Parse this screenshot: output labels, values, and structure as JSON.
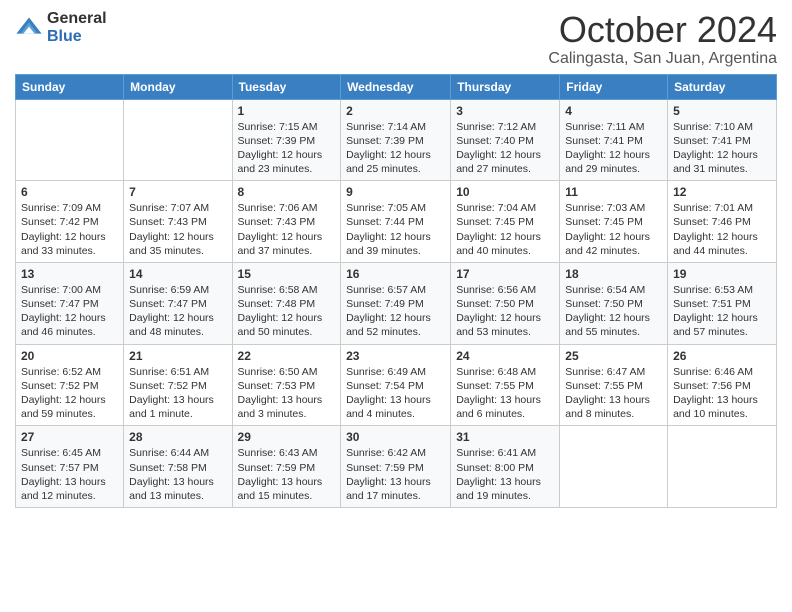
{
  "logo": {
    "general": "General",
    "blue": "Blue"
  },
  "header": {
    "month": "October 2024",
    "location": "Calingasta, San Juan, Argentina"
  },
  "weekdays": [
    "Sunday",
    "Monday",
    "Tuesday",
    "Wednesday",
    "Thursday",
    "Friday",
    "Saturday"
  ],
  "weeks": [
    [
      {
        "day": "",
        "sunrise": "",
        "sunset": "",
        "daylight": ""
      },
      {
        "day": "",
        "sunrise": "",
        "sunset": "",
        "daylight": ""
      },
      {
        "day": "1",
        "sunrise": "Sunrise: 7:15 AM",
        "sunset": "Sunset: 7:39 PM",
        "daylight": "Daylight: 12 hours and 23 minutes."
      },
      {
        "day": "2",
        "sunrise": "Sunrise: 7:14 AM",
        "sunset": "Sunset: 7:39 PM",
        "daylight": "Daylight: 12 hours and 25 minutes."
      },
      {
        "day": "3",
        "sunrise": "Sunrise: 7:12 AM",
        "sunset": "Sunset: 7:40 PM",
        "daylight": "Daylight: 12 hours and 27 minutes."
      },
      {
        "day": "4",
        "sunrise": "Sunrise: 7:11 AM",
        "sunset": "Sunset: 7:41 PM",
        "daylight": "Daylight: 12 hours and 29 minutes."
      },
      {
        "day": "5",
        "sunrise": "Sunrise: 7:10 AM",
        "sunset": "Sunset: 7:41 PM",
        "daylight": "Daylight: 12 hours and 31 minutes."
      }
    ],
    [
      {
        "day": "6",
        "sunrise": "Sunrise: 7:09 AM",
        "sunset": "Sunset: 7:42 PM",
        "daylight": "Daylight: 12 hours and 33 minutes."
      },
      {
        "day": "7",
        "sunrise": "Sunrise: 7:07 AM",
        "sunset": "Sunset: 7:43 PM",
        "daylight": "Daylight: 12 hours and 35 minutes."
      },
      {
        "day": "8",
        "sunrise": "Sunrise: 7:06 AM",
        "sunset": "Sunset: 7:43 PM",
        "daylight": "Daylight: 12 hours and 37 minutes."
      },
      {
        "day": "9",
        "sunrise": "Sunrise: 7:05 AM",
        "sunset": "Sunset: 7:44 PM",
        "daylight": "Daylight: 12 hours and 39 minutes."
      },
      {
        "day": "10",
        "sunrise": "Sunrise: 7:04 AM",
        "sunset": "Sunset: 7:45 PM",
        "daylight": "Daylight: 12 hours and 40 minutes."
      },
      {
        "day": "11",
        "sunrise": "Sunrise: 7:03 AM",
        "sunset": "Sunset: 7:45 PM",
        "daylight": "Daylight: 12 hours and 42 minutes."
      },
      {
        "day": "12",
        "sunrise": "Sunrise: 7:01 AM",
        "sunset": "Sunset: 7:46 PM",
        "daylight": "Daylight: 12 hours and 44 minutes."
      }
    ],
    [
      {
        "day": "13",
        "sunrise": "Sunrise: 7:00 AM",
        "sunset": "Sunset: 7:47 PM",
        "daylight": "Daylight: 12 hours and 46 minutes."
      },
      {
        "day": "14",
        "sunrise": "Sunrise: 6:59 AM",
        "sunset": "Sunset: 7:47 PM",
        "daylight": "Daylight: 12 hours and 48 minutes."
      },
      {
        "day": "15",
        "sunrise": "Sunrise: 6:58 AM",
        "sunset": "Sunset: 7:48 PM",
        "daylight": "Daylight: 12 hours and 50 minutes."
      },
      {
        "day": "16",
        "sunrise": "Sunrise: 6:57 AM",
        "sunset": "Sunset: 7:49 PM",
        "daylight": "Daylight: 12 hours and 52 minutes."
      },
      {
        "day": "17",
        "sunrise": "Sunrise: 6:56 AM",
        "sunset": "Sunset: 7:50 PM",
        "daylight": "Daylight: 12 hours and 53 minutes."
      },
      {
        "day": "18",
        "sunrise": "Sunrise: 6:54 AM",
        "sunset": "Sunset: 7:50 PM",
        "daylight": "Daylight: 12 hours and 55 minutes."
      },
      {
        "day": "19",
        "sunrise": "Sunrise: 6:53 AM",
        "sunset": "Sunset: 7:51 PM",
        "daylight": "Daylight: 12 hours and 57 minutes."
      }
    ],
    [
      {
        "day": "20",
        "sunrise": "Sunrise: 6:52 AM",
        "sunset": "Sunset: 7:52 PM",
        "daylight": "Daylight: 12 hours and 59 minutes."
      },
      {
        "day": "21",
        "sunrise": "Sunrise: 6:51 AM",
        "sunset": "Sunset: 7:52 PM",
        "daylight": "Daylight: 13 hours and 1 minute."
      },
      {
        "day": "22",
        "sunrise": "Sunrise: 6:50 AM",
        "sunset": "Sunset: 7:53 PM",
        "daylight": "Daylight: 13 hours and 3 minutes."
      },
      {
        "day": "23",
        "sunrise": "Sunrise: 6:49 AM",
        "sunset": "Sunset: 7:54 PM",
        "daylight": "Daylight: 13 hours and 4 minutes."
      },
      {
        "day": "24",
        "sunrise": "Sunrise: 6:48 AM",
        "sunset": "Sunset: 7:55 PM",
        "daylight": "Daylight: 13 hours and 6 minutes."
      },
      {
        "day": "25",
        "sunrise": "Sunrise: 6:47 AM",
        "sunset": "Sunset: 7:55 PM",
        "daylight": "Daylight: 13 hours and 8 minutes."
      },
      {
        "day": "26",
        "sunrise": "Sunrise: 6:46 AM",
        "sunset": "Sunset: 7:56 PM",
        "daylight": "Daylight: 13 hours and 10 minutes."
      }
    ],
    [
      {
        "day": "27",
        "sunrise": "Sunrise: 6:45 AM",
        "sunset": "Sunset: 7:57 PM",
        "daylight": "Daylight: 13 hours and 12 minutes."
      },
      {
        "day": "28",
        "sunrise": "Sunrise: 6:44 AM",
        "sunset": "Sunset: 7:58 PM",
        "daylight": "Daylight: 13 hours and 13 minutes."
      },
      {
        "day": "29",
        "sunrise": "Sunrise: 6:43 AM",
        "sunset": "Sunset: 7:59 PM",
        "daylight": "Daylight: 13 hours and 15 minutes."
      },
      {
        "day": "30",
        "sunrise": "Sunrise: 6:42 AM",
        "sunset": "Sunset: 7:59 PM",
        "daylight": "Daylight: 13 hours and 17 minutes."
      },
      {
        "day": "31",
        "sunrise": "Sunrise: 6:41 AM",
        "sunset": "Sunset: 8:00 PM",
        "daylight": "Daylight: 13 hours and 19 minutes."
      },
      {
        "day": "",
        "sunrise": "",
        "sunset": "",
        "daylight": ""
      },
      {
        "day": "",
        "sunrise": "",
        "sunset": "",
        "daylight": ""
      }
    ]
  ]
}
